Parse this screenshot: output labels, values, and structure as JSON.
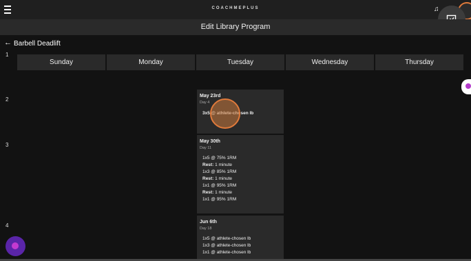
{
  "app": {
    "brand": "COACHMEPLUS"
  },
  "header": {
    "title": "Edit Library Program"
  },
  "program": {
    "name": "Barbell Deadlift"
  },
  "weeks": [
    "1",
    "2",
    "3",
    "4"
  ],
  "days": [
    "Sunday",
    "Monday",
    "Tuesday",
    "Wednesday",
    "Thursday"
  ],
  "cards": [
    {
      "date": "May 23rd",
      "day": "Day 4",
      "lines": [
        {
          "text": "3x5  @ athlete-chosen lb",
          "bold": true
        }
      ]
    },
    {
      "date": "May 30th",
      "day": "Day 11",
      "lines": [
        {
          "text": "1x5  @ 75% 1RM"
        },
        {
          "label": "Rest:",
          "text": " 1 minute"
        },
        {
          "text": "1x3  @ 85% 1RM"
        },
        {
          "label": "Rest:",
          "text": " 1 minute"
        },
        {
          "text": "1x1  @ 95% 1RM"
        },
        {
          "label": "Rest:",
          "text": " 1 minute"
        },
        {
          "text": "1x1  @ 95% 1RM"
        }
      ]
    },
    {
      "date": "Jun 6th",
      "day": "Day 18",
      "lines": [
        {
          "text": "1x5  @ athlete-chosen lb"
        },
        {
          "text": "1x3  @ athlete-chosen lb"
        },
        {
          "text": "1x1  @ athlete-chosen lb"
        }
      ]
    }
  ],
  "icons": {
    "menu": "menu-icon",
    "notifications": "bell-icon",
    "back": "arrow-left-icon",
    "more": "more-vertical-icon",
    "image": "image-edit-icon"
  },
  "colors": {
    "accent": "#e07a3b",
    "purple": "#5a25a8"
  }
}
